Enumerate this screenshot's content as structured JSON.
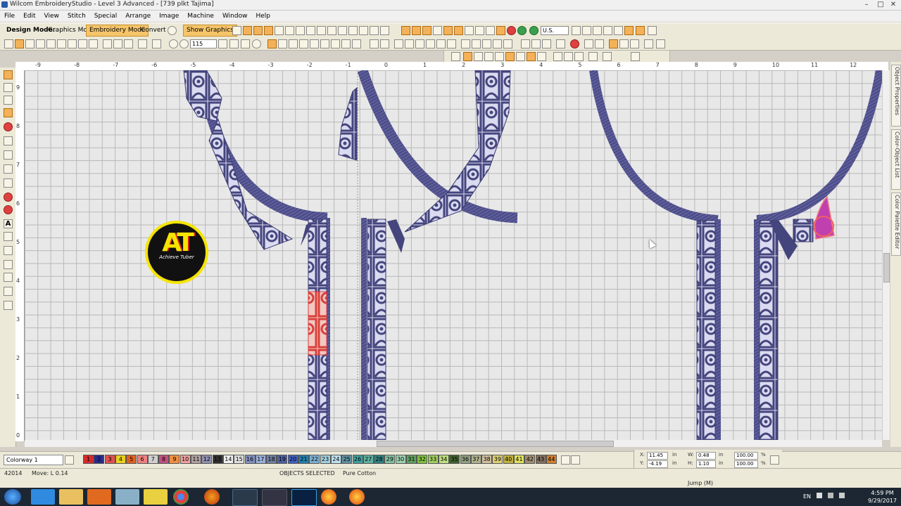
{
  "window": {
    "title": "Wilcom EmbroideryStudio - Level 3 Advanced - [739 plkt    Tajima]"
  },
  "menu": [
    "File",
    "Edit",
    "View",
    "Stitch",
    "Special",
    "Arrange",
    "Image",
    "Machine",
    "Window",
    "Help"
  ],
  "toolbar": {
    "design_mode_label": "Design Mode:",
    "graphics_mode": "Graphics Mode",
    "embroidery_mode": "Embroidery Mode",
    "convert": "Convert",
    "show_graphics": "Show Graphics",
    "zoom_value": "115",
    "units_value": "U.S."
  },
  "ruler": {
    "h_ticks": [
      "-9",
      "-8",
      "-7",
      "-6",
      "-5",
      "-4",
      "-3",
      "-2",
      "-1",
      "0",
      "1",
      "2",
      "3",
      "4",
      "5",
      "6",
      "7",
      "8",
      "9",
      "10",
      "11",
      "12"
    ],
    "v_ticks": [
      "9",
      "8",
      "7",
      "6",
      "5",
      "4",
      "3",
      "2",
      "1",
      "0"
    ]
  },
  "logo": {
    "big": "AT",
    "small": "Achieve Tuber"
  },
  "dock_tabs": [
    "Object Properties",
    "Color-Object List",
    "Color Palette Editor"
  ],
  "palette": {
    "colorway": "Colorway 1",
    "swatches": [
      {
        "n": "1",
        "c": "#d42a2a"
      },
      {
        "n": "2",
        "c": "#2a2a8a"
      },
      {
        "n": "3",
        "c": "#e05050"
      },
      {
        "n": "4",
        "c": "#e8d020"
      },
      {
        "n": "5",
        "c": "#e06020"
      },
      {
        "n": "6",
        "c": "#f08080"
      },
      {
        "n": "7",
        "c": "#d0d0d0"
      },
      {
        "n": "8",
        "c": "#c05080"
      },
      {
        "n": "9",
        "c": "#f09040"
      },
      {
        "n": "10",
        "c": "#f0a0a0"
      },
      {
        "n": "11",
        "c": "#b0a0a0"
      },
      {
        "n": "12",
        "c": "#9090b0"
      },
      {
        "n": "13",
        "c": "#303030"
      },
      {
        "n": "14",
        "c": "#f0f0f0"
      },
      {
        "n": "15",
        "c": "#e0e0e0"
      },
      {
        "n": "16",
        "c": "#8090c0"
      },
      {
        "n": "17",
        "c": "#9ab0d8"
      },
      {
        "n": "18",
        "c": "#7080a0"
      },
      {
        "n": "19",
        "c": "#5060a0"
      },
      {
        "n": "20",
        "c": "#4060c0"
      },
      {
        "n": "21",
        "c": "#2080b0"
      },
      {
        "n": "22",
        "c": "#80b0d0"
      },
      {
        "n": "23",
        "c": "#a0d0e0"
      },
      {
        "n": "24",
        "c": "#c0e0f0"
      },
      {
        "n": "25",
        "c": "#6090a0"
      },
      {
        "n": "26",
        "c": "#40a0a0"
      },
      {
        "n": "27",
        "c": "#60b0a0"
      },
      {
        "n": "28",
        "c": "#308080"
      },
      {
        "n": "29",
        "c": "#80c0a0"
      },
      {
        "n": "30",
        "c": "#a0d0b0"
      },
      {
        "n": "31",
        "c": "#60a060"
      },
      {
        "n": "32",
        "c": "#80c040"
      },
      {
        "n": "33",
        "c": "#a0d060"
      },
      {
        "n": "34",
        "c": "#c0e080"
      },
      {
        "n": "35",
        "c": "#406030"
      },
      {
        "n": "36",
        "c": "#90a080"
      },
      {
        "n": "37",
        "c": "#b0b090"
      },
      {
        "n": "38",
        "c": "#d0c0a0"
      },
      {
        "n": "39",
        "c": "#e0d070"
      },
      {
        "n": "40",
        "c": "#c0b040"
      },
      {
        "n": "41",
        "c": "#e0e060"
      },
      {
        "n": "42",
        "c": "#a09070"
      },
      {
        "n": "43",
        "c": "#807060"
      },
      {
        "n": "44",
        "c": "#d08030"
      }
    ]
  },
  "coords": {
    "x_label": "X:",
    "x_val": "11.45",
    "y_label": "Y:",
    "y_val": "-4.19",
    "w_label": "W:",
    "w_val": "0.48",
    "h_label": "H:",
    "h_val": "1.10",
    "unit": "in",
    "pw": "100.00",
    "ph": "100.00",
    "pct": "%"
  },
  "status": {
    "stitches": "42014",
    "move": "Move: L  0.14",
    "objects": "OBJECTS SELECTED",
    "fabric": "Pure Cotton",
    "jump": "Jump (M)"
  },
  "tray": {
    "lang": "EN",
    "time": "4:59 PM",
    "date": "9/29/2017"
  },
  "colors": {
    "thread": "#4a4a82",
    "accent_red": "#d8403a",
    "selection": "#c040b0",
    "mode_on": "#f6c56a"
  }
}
